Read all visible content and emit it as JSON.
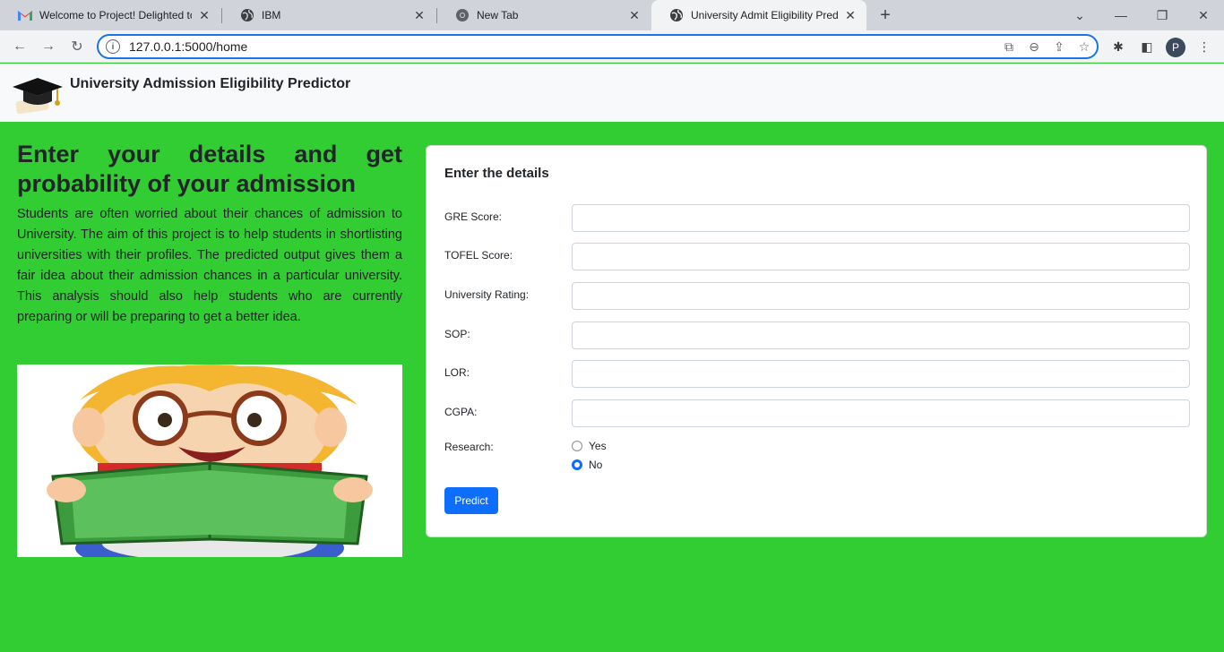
{
  "browser": {
    "tabs": [
      {
        "title": "Welcome to Project! Delighted to",
        "icon": "gmail-icon"
      },
      {
        "title": "IBM",
        "icon": "globe-icon"
      },
      {
        "title": "New Tab",
        "icon": "chrome-icon"
      },
      {
        "title": "University Admit Eligibility Predic",
        "icon": "globe-icon",
        "active": true
      }
    ],
    "url": "127.0.0.1:5000/home",
    "profile_initial": "P"
  },
  "header": {
    "brand": "University Admission Eligibility Predictor"
  },
  "hero": {
    "title": "Enter your details and get probability of your admission",
    "description": "Students are often worried about their chances of admission to University. The aim of this project is to help students in shortlisting universities with their profiles. The predicted output gives them a fair idea about their admission chances in a particular university. This analysis should also help students who are currently preparing or will be preparing to get a better idea."
  },
  "form": {
    "title": "Enter the details",
    "fields": [
      {
        "label": "GRE Score:",
        "value": ""
      },
      {
        "label": "TOFEL Score:",
        "value": ""
      },
      {
        "label": "University Rating:",
        "value": ""
      },
      {
        "label": "SOP:",
        "value": ""
      },
      {
        "label": "LOR:",
        "value": ""
      },
      {
        "label": "CGPA:",
        "value": ""
      }
    ],
    "research_label": "Research:",
    "research_options": [
      "Yes",
      "No"
    ],
    "research_selected": "No",
    "submit_label": "Predict"
  },
  "colors": {
    "page_background": "#32cd32",
    "primary_button": "#0d6efd"
  }
}
